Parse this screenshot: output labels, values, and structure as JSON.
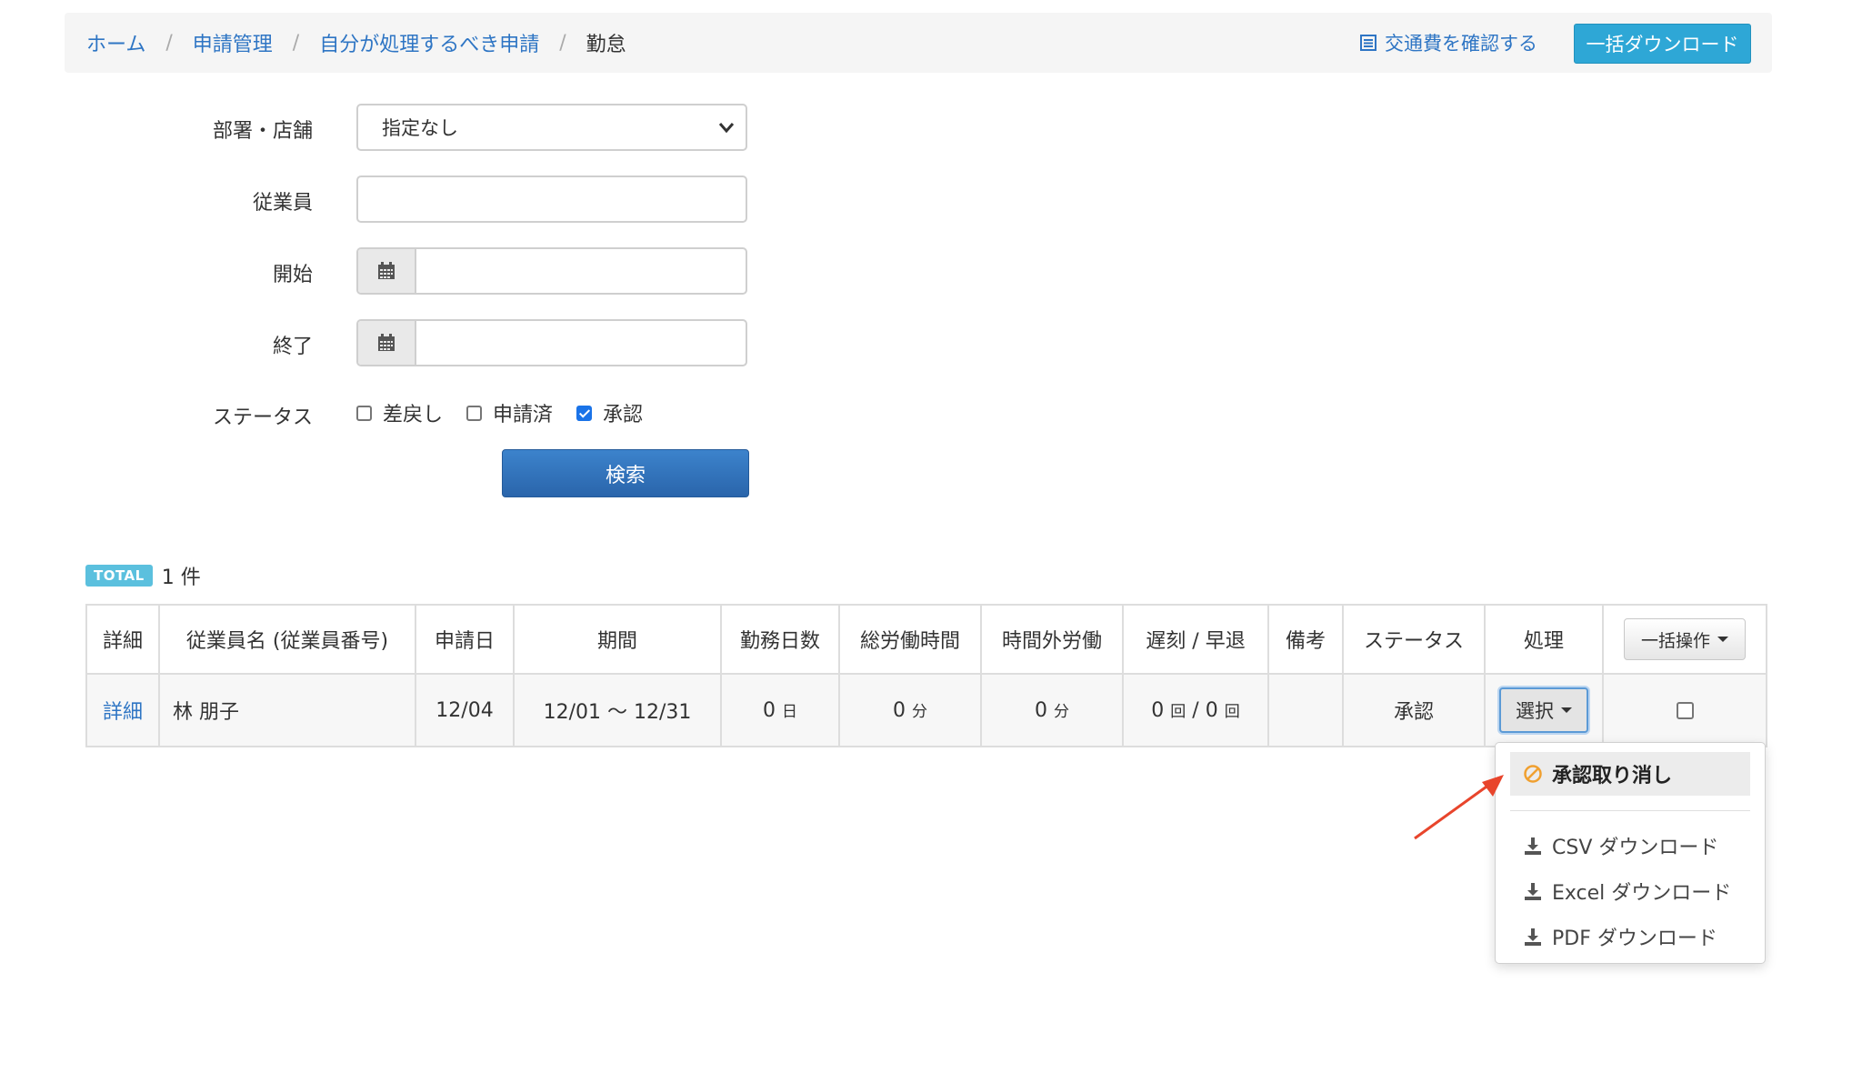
{
  "breadcrumb": {
    "items": [
      "ホーム",
      "申請管理",
      "自分が処理するべき申請"
    ],
    "current": "勤怠",
    "separator": "/"
  },
  "header": {
    "commute_link": "交通費を確認する",
    "bulk_download_button": "一括ダウンロード"
  },
  "form": {
    "department_label": "部署・店舗",
    "department_value": "指定なし",
    "employee_label": "従業員",
    "employee_value": "",
    "start_label": "開始",
    "start_value": "",
    "end_label": "終了",
    "end_value": "",
    "status_label": "ステータス",
    "status_options": [
      {
        "label": "差戻し",
        "checked": false
      },
      {
        "label": "申請済",
        "checked": false
      },
      {
        "label": "承認",
        "checked": true
      }
    ],
    "search_button": "検索"
  },
  "total": {
    "badge": "TOTAL",
    "count_text": "1 件"
  },
  "table": {
    "headers": [
      "詳細",
      "従業員名 (従業員番号)",
      "申請日",
      "期間",
      "勤務日数",
      "総労働時間",
      "時間外労働",
      "遅刻 / 早退",
      "備考",
      "ステータス",
      "処理"
    ],
    "bulk_ops_button": "一括操作",
    "rows": [
      {
        "detail": "詳細",
        "employee": "林 朋子",
        "applied": "12/04",
        "period": "12/01 〜 12/31",
        "work_days": "0",
        "work_days_unit": "日",
        "total_hours": "0",
        "total_hours_unit": "分",
        "overtime": "0",
        "overtime_unit": "分",
        "late": "0",
        "late_unit": "回",
        "late_sep": " / ",
        "early": "0",
        "early_unit": "回",
        "remarks": "",
        "status": "承認",
        "action_button": "選択"
      }
    ]
  },
  "dropdown": {
    "items": [
      {
        "label": "承認取り消し",
        "icon": "ban-icon"
      },
      {
        "label": "CSV ダウンロード",
        "icon": "download-icon"
      },
      {
        "label": "Excel ダウンロード",
        "icon": "download-icon"
      },
      {
        "label": "PDF ダウンロード",
        "icon": "download-icon"
      }
    ]
  },
  "colors": {
    "link": "#2e75c4",
    "primary_button": "#2a65ab",
    "info_button": "#2ea7d6",
    "badge": "#5bc0de",
    "annotation_arrow": "#e8452c"
  }
}
